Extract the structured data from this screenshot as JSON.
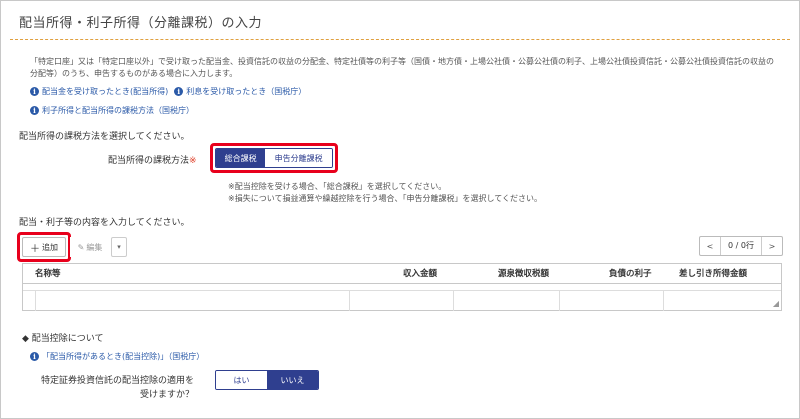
{
  "page": {
    "title": "配当所得・利子所得（分離課税）の入力"
  },
  "intro": {
    "text": "「特定口座」又は「特定口座以外」で受け取った配当金、投資信託の収益の分配金、特定社債等の利子等（国債・地方債・上場公社債・公募公社債の利子、上場公社債投資信託・公募公社債投資信託の収益の分配等）のうち、申告するものがある場合に入力します。"
  },
  "links": {
    "dividend_received": "配当金を受け取ったとき(配当所得)",
    "interest_received": "利息を受け取ったとき（国税庁）",
    "tax_method": "利子所得と配当所得の課税方法（国税庁）"
  },
  "taxation": {
    "heading": "配当所得の課税方法を選択してください。",
    "label": "配当所得の課税方法",
    "required_mark": "※",
    "options": [
      "総合課税",
      "申告分離課税"
    ],
    "selected": "総合課税",
    "note1": "※配当控除を受ける場合、「総合課税」を選択してください。",
    "note2": "※損失について損益通算や繰越控除を行う場合、「申告分離課税」を選択してください。"
  },
  "details": {
    "heading": "配当・利子等の内容を入力してください。",
    "add_label": "追加",
    "edit_label": "編集",
    "more_label": "▾",
    "pager_prev": "<",
    "pager_text": "0 / 0行",
    "pager_next": ">",
    "columns": [
      "名称等",
      "収入金額",
      "源泉徴収税額",
      "負債の利子",
      "差し引き所得金額"
    ]
  },
  "deduction": {
    "title": "配当控除について",
    "link": "「配当所得があるとき(配当控除)」（国税庁）",
    "question_line1": "特定証券投資信託の配当控除の適用を",
    "question_line2": "受けますか？",
    "options": [
      "はい",
      "いいえ"
    ],
    "selected": "いいえ"
  },
  "icons": {
    "info": "info-icon",
    "plus": "plus-icon",
    "pencil": "pencil-icon",
    "diamond": "diamond-bullet-icon"
  },
  "colors": {
    "accent": "#2f3f8f",
    "link": "#2b5aa8",
    "highlight": "#e8001c",
    "rule": "#e0a040"
  }
}
